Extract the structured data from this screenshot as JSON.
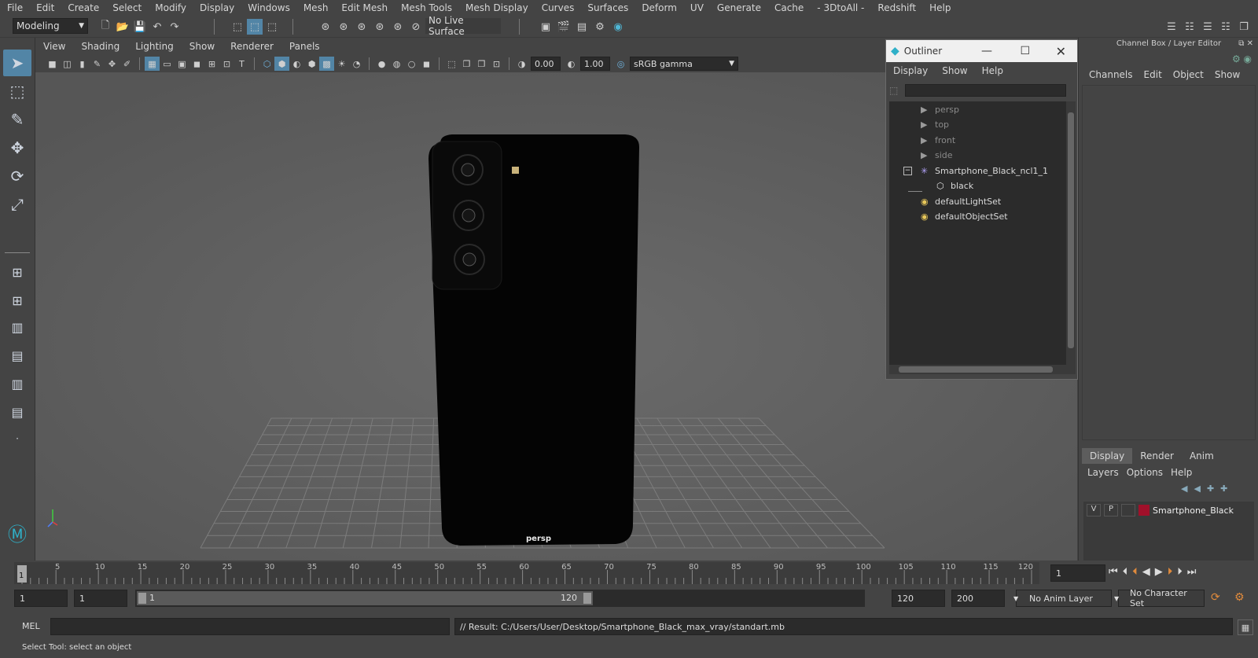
{
  "menubar": {
    "items": [
      "File",
      "Edit",
      "Create",
      "Select",
      "Modify",
      "Display",
      "Windows",
      "Mesh",
      "Edit Mesh",
      "Mesh Tools",
      "Mesh Display",
      "Curves",
      "Surfaces",
      "Deform",
      "UV",
      "Generate",
      "Cache",
      "- 3DtoAll -",
      "Redshift",
      "Help"
    ]
  },
  "statusline": {
    "workspace": "Modeling",
    "live_surface": "No Live Surface"
  },
  "viewport": {
    "menu": [
      "View",
      "Shading",
      "Lighting",
      "Show",
      "Renderer",
      "Panels"
    ],
    "exposure": "0.00",
    "gamma": "1.00",
    "color_space": "sRGB gamma",
    "camera_label": "persp"
  },
  "outliner": {
    "title": "Outliner",
    "menu": [
      "Display",
      "Show",
      "Help"
    ],
    "items": [
      {
        "label": "persp",
        "icon": "camera-icon",
        "dim": true
      },
      {
        "label": "top",
        "icon": "camera-icon",
        "dim": true
      },
      {
        "label": "front",
        "icon": "camera-icon",
        "dim": true
      },
      {
        "label": "side",
        "icon": "camera-icon",
        "dim": true
      },
      {
        "label": "Smartphone_Black_ncl1_1",
        "icon": "group-icon",
        "dim": false
      },
      {
        "label": "black",
        "icon": "mesh-icon",
        "dim": false
      },
      {
        "label": "defaultLightSet",
        "icon": "set-icon",
        "dim": false
      },
      {
        "label": "defaultObjectSet",
        "icon": "set-icon",
        "dim": false
      }
    ]
  },
  "channelbox": {
    "title": "Channel Box / Layer Editor",
    "menu": [
      "Channels",
      "Edit",
      "Object",
      "Show"
    ],
    "tabs": [
      "Display",
      "Render",
      "Anim"
    ],
    "layer_menu": [
      "Layers",
      "Options",
      "Help"
    ],
    "layer": {
      "v": "V",
      "p": "P",
      "name": "Smartphone_Black",
      "color": "#a0102a"
    }
  },
  "timeline": {
    "ticks": [
      "5",
      "10",
      "15",
      "20",
      "25",
      "30",
      "35",
      "40",
      "45",
      "50",
      "55",
      "60",
      "65",
      "70",
      "75",
      "80",
      "85",
      "90",
      "95",
      "100",
      "105",
      "110",
      "115",
      "120"
    ],
    "current_marker": "1",
    "current_frame": "1"
  },
  "range": {
    "start": "1",
    "playback_start": "1",
    "slider_start": "1",
    "slider_end": "120",
    "playback_end": "120",
    "end": "200",
    "anim_layer": "No Anim Layer",
    "character_set": "No Character Set"
  },
  "cmdline": {
    "lang": "MEL",
    "result": "// Result: C:/Users/User/Desktop/Smartphone_Black_max_vray/standart.mb"
  },
  "helpline": {
    "text": "Select Tool: select an object"
  }
}
